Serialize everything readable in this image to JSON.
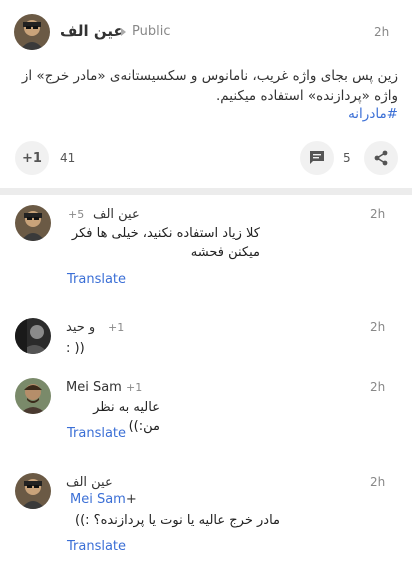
{
  "post": {
    "author": "عین الف",
    "visibility": "Public",
    "time": "2h",
    "text": "زین پس بجای واژه غریب، نامانوس و سکسیستانه‌ی «مادر خرج» از واژه «پردازنده» استفاده میکنیم.",
    "hashtag": "#مادرانه",
    "plus_label": "+1",
    "plus_count": "41",
    "comment_count": "5",
    "icons": {
      "comment": "comment-icon",
      "share": "share-icon"
    }
  },
  "comments": [
    {
      "author": "عین الف",
      "plus": "+5",
      "time": "2h",
      "text": "کلا زیاد استفاده نکنید، خیلی ها فکر میکنن فحشه",
      "translate": "Translate"
    },
    {
      "author": "و حید",
      "plus": "+1",
      "time": "2h",
      "text": ":  ))"
    },
    {
      "author": "Mei Sam",
      "plus": "+1",
      "time": "2h",
      "text": "عالیه به نظر من:))",
      "translate": "Translate"
    },
    {
      "author": "عین الف",
      "time": "2h",
      "mention": "Mei Sam",
      "mention_plus": "+",
      "text": "مادر خرج عالیه یا نوت یا پردازنده؟ :))",
      "translate": "Translate"
    }
  ],
  "colors": {
    "link": "#3b6fd6",
    "background": "#ececec"
  }
}
